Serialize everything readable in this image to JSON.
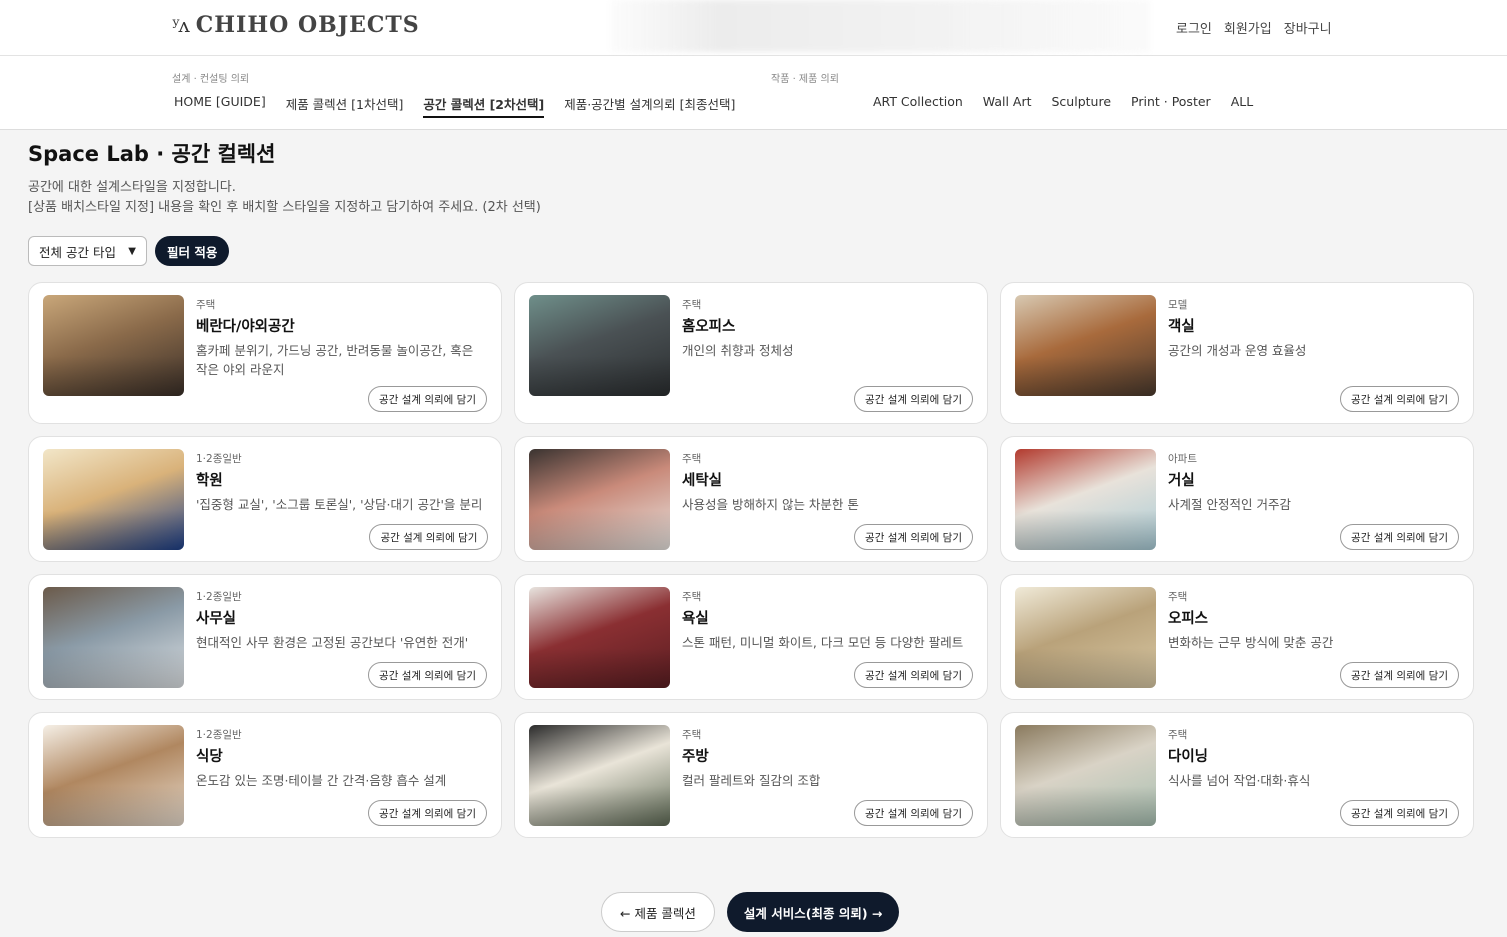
{
  "header": {
    "logo_mark": "ʸʌ",
    "logo_text": "CHIHO OBJECTS",
    "links": [
      "로그인",
      "회원가입",
      "장바구니"
    ]
  },
  "nav": {
    "group1_label": "설계 · 컨설팅 의뢰",
    "group1_items": [
      {
        "label": "HOME [GUIDE]",
        "active": false
      },
      {
        "label": "제품 콜렉션 [1차선택]",
        "active": false
      },
      {
        "label": "공간 콜렉션 [2차선택]",
        "active": true
      },
      {
        "label": "제품·공간별 설계의뢰 [최종선택]",
        "active": false
      }
    ],
    "group2_label": "작품 · 제품 의뢰",
    "group2_items": [
      {
        "label": "ART Collection"
      },
      {
        "label": "Wall Art"
      },
      {
        "label": "Sculpture"
      },
      {
        "label": "Print · Poster"
      },
      {
        "label": "ALL"
      }
    ]
  },
  "page": {
    "title": "Space Lab · 공간 컬렉션",
    "desc_line1": "공간에 대한 설계스타일을 지정합니다.",
    "desc_line2": "[상품 배치스타일 지정] 내용을 확인 후 배치할 스타일을 지정하고 담기하여 주세요. (2차 선택)"
  },
  "filter": {
    "select_value": "전체 공간 타입",
    "apply_label": "필터 적용"
  },
  "add_label": "공간 설계 의뢰에 담기",
  "cards": [
    {
      "type": "주택",
      "name": "베란다/야외공간",
      "desc": "홈카페 분위기, 가드닝 공간, 반려동물 놀이공간, 혹은 작은 야외 라운지",
      "colors": [
        "#3a2f28",
        "#8a6a4a",
        "#c9a77a"
      ]
    },
    {
      "type": "주택",
      "name": "홈오피스",
      "desc": "개인의 취향과 정체성",
      "colors": [
        "#2b2e30",
        "#4a5154",
        "#6f8f8a"
      ]
    },
    {
      "type": "모델",
      "name": "객실",
      "desc": "공간의 개성과 운영 효율성",
      "colors": [
        "#4a3a2e",
        "#a86a3c",
        "#d8c9b2"
      ]
    },
    {
      "type": "1·2종일반",
      "name": "학원",
      "desc": "'집중형 교실', '소그룹 토론실', '상담·대기 공간'을 분리",
      "colors": [
        "#1c3f8a",
        "#d9b27a",
        "#f2e6c8"
      ]
    },
    {
      "type": "주택",
      "name": "세탁실",
      "desc": "사용성을 방해하지 않는 차분한 톤",
      "colors": [
        "#e9e5e1",
        "#c98a7a",
        "#3a3330"
      ]
    },
    {
      "type": "아파트",
      "name": "거실",
      "desc": "사계절 안정적인 거주감",
      "colors": [
        "#a8cbd6",
        "#e8e2da",
        "#b23a2e"
      ]
    },
    {
      "type": "1·2종일반",
      "name": "사무실",
      "desc": "현대적인 사무 환경은 고정된 공간보다 '유연한 전개'",
      "colors": [
        "#dfe3e6",
        "#8a9aa6",
        "#6b5a4a"
      ]
    },
    {
      "type": "주택",
      "name": "욕실",
      "desc": "스톤 패턴, 미니멀 화이트, 다크 모던 등 다양한 팔레트",
      "colors": [
        "#5a1e22",
        "#8a2f32",
        "#e8e4df"
      ]
    },
    {
      "type": "주택",
      "name": "오피스",
      "desc": "변화하는 근무 방식에 맞춘 공간",
      "colors": [
        "#d9c9a5",
        "#b9a27a",
        "#f0ead8"
      ]
    },
    {
      "type": "1·2종일반",
      "name": "식당",
      "desc": "온도감 있는 조명·테이블 간 간격·음향 흡수 설계",
      "colors": [
        "#e9ddcf",
        "#b08760",
        "#f5efe6"
      ]
    },
    {
      "type": "주택",
      "name": "주방",
      "desc": "컬러 팔레트와 질감의 조합",
      "colors": [
        "#5e6a55",
        "#e9e4d8",
        "#2b2b2b"
      ]
    },
    {
      "type": "주택",
      "name": "다이닝",
      "desc": "식사를 넘어 작업·대화·휴식",
      "colors": [
        "#a7bfb1",
        "#d9d3c6",
        "#8a7a5e"
      ]
    }
  ],
  "bottom": {
    "prev_label": "← 제품 콜렉션",
    "next_label": "설계 서비스(최종 의뢰) →"
  }
}
